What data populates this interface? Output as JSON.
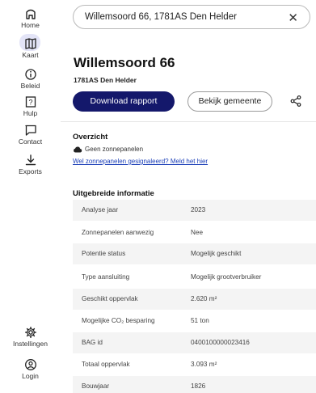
{
  "sidebar": {
    "top_items": [
      {
        "label": "Home",
        "icon": "home-icon"
      },
      {
        "label": "Kaart",
        "icon": "map-icon",
        "active": true
      },
      {
        "label": "Beleid",
        "icon": "info-icon"
      },
      {
        "label": "Hulp",
        "icon": "help-icon"
      },
      {
        "label": "Contact",
        "icon": "chat-icon"
      },
      {
        "label": "Exports",
        "icon": "download-icon"
      }
    ],
    "bottom_items": [
      {
        "label": "Instellingen",
        "icon": "gear-icon"
      },
      {
        "label": "Login",
        "icon": "user-icon"
      }
    ]
  },
  "search": {
    "value": "Willemsoord 66, 1781AS Den Helder",
    "clear": "✕"
  },
  "header": {
    "title": "Willemsoord 66",
    "subtitle": "1781AS Den Helder"
  },
  "actions": {
    "download_label": "Download rapport",
    "municipality_label": "Bekijk gemeente"
  },
  "overview": {
    "title": "Overzicht",
    "solar_status": "Geen zonnepanelen",
    "report_link": "Wel zonnepanelen gesignaleerd? Meld het hier"
  },
  "details": {
    "title": "Uitgebreide informatie",
    "rows": [
      {
        "label": "Analyse jaar",
        "value": "2023"
      },
      {
        "label": "Zonnepanelen aanwezig",
        "value": "Nee"
      },
      {
        "label": "Potentie status",
        "value": "Mogelijk geschikt"
      },
      {
        "label": "Type aansluiting",
        "value": "Mogelijk grootverbruiker"
      },
      {
        "label": "Geschikt oppervlak",
        "value": "2.620 m²"
      },
      {
        "label": "Mogelijke CO₂ besparing",
        "value": "51 ton"
      },
      {
        "label": "BAG id",
        "value": "0400100000023416"
      },
      {
        "label": "Totaal oppervlak",
        "value": "3.093 m²"
      },
      {
        "label": "Bouwjaar",
        "value": "1826"
      }
    ]
  },
  "colors": {
    "primary": "#14186b",
    "link": "#1b3fb8",
    "active_nav": "#e3e4f7"
  }
}
